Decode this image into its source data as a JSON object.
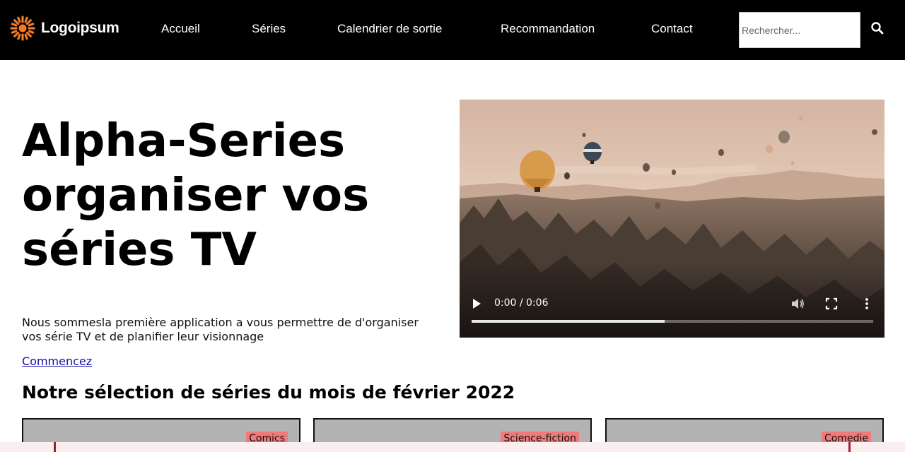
{
  "nav": {
    "logo_text": "Logoipsum",
    "links": [
      "Accueil",
      "Séries",
      "Calendrier de sortie",
      "Recommandation",
      "Contact"
    ],
    "search_placeholder": "Rechercher...",
    "search_icon": "search-icon"
  },
  "hero": {
    "title": "Alpha-Series organiser vos séries TV",
    "description": "Nous sommesla première application a vous permettre de d'organiser vos série TV et de planifier leur visionnage",
    "cta": "Commencez"
  },
  "video": {
    "time": "0:00 / 0:06",
    "progress": 0.48,
    "icons": [
      "play-icon",
      "volume-icon",
      "fullscreen-icon",
      "more-options-icon"
    ]
  },
  "selection": {
    "title": "Notre sélection de séries du mois de février 2022",
    "cards": [
      {
        "category": "Comics"
      },
      {
        "category": "Science-fiction"
      },
      {
        "category": "Comedie"
      }
    ]
  },
  "colors": {
    "nav_bg": "#000000",
    "logo_accent": "#f47a20",
    "badge": "#f07a7a",
    "card_bg": "#b3b3b3",
    "link": "#1a0dab",
    "bottom_bar": "#fbeeee",
    "bottom_edge": "#a41f2b"
  }
}
